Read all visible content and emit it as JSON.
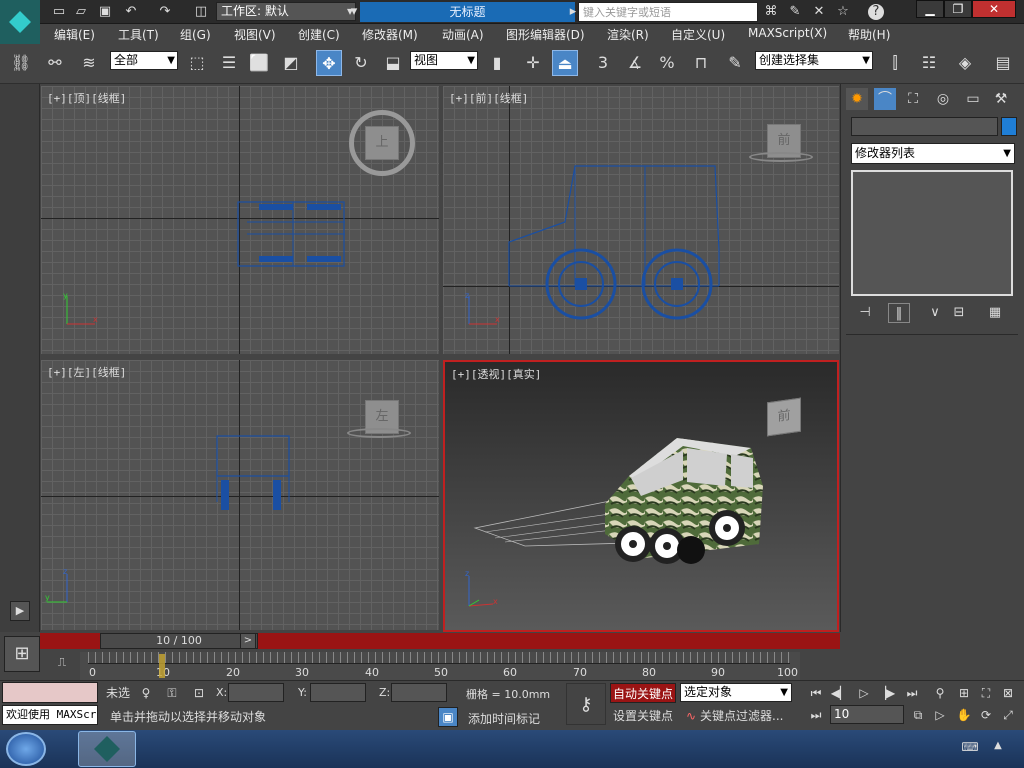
{
  "title": {
    "workspace": "工作区: 默认",
    "document": "无标题",
    "search_placeholder": "键入关键字或短语"
  },
  "menu": [
    "编辑(E)",
    "工具(T)",
    "组(G)",
    "视图(V)",
    "创建(C)",
    "修改器(M)",
    "动画(A)",
    "图形编辑器(D)",
    "渲染(R)",
    "自定义(U)",
    "MAXScript(X)",
    "帮助(H)"
  ],
  "toolbar": {
    "selection_filter": "全部",
    "ref_coord": "视图",
    "named_selection": "创建选择集",
    "snap_3": "3",
    "percent": "%"
  },
  "viewports": {
    "top": "[+][顶][线框]",
    "front": "[+][前][线框]",
    "left": "[+][左][线框]",
    "persp": "[+][透视][真实]",
    "cube_top": "上",
    "cube_front": "前",
    "cube_left": "左",
    "cube_persp": "前"
  },
  "command_panel": {
    "modifier_list": "修改器列表"
  },
  "timeline": {
    "slider_label": "10 / 100",
    "ticks": [
      "0",
      "10",
      "20",
      "30",
      "40",
      "50",
      "60",
      "70",
      "80",
      "90",
      "100"
    ],
    "prev": "<",
    "next": ">"
  },
  "status": {
    "listener_text": "欢迎使用 MAXScr",
    "selection_state": "未选",
    "x_label": "X:",
    "y_label": "Y:",
    "z_label": "Z:",
    "grid": "栅格 = 10.0mm",
    "prompt": "单击并拖动以选择并移动对象",
    "add_time_tag": "添加时间标记",
    "autokey": "自动关键点",
    "set_key": "设置关键点",
    "selected_object": "选定对象",
    "key_filters": "关键点过滤器...",
    "current_frame": "10"
  },
  "colors": {
    "accent_blue": "#1f7ed6",
    "autokey_red": "#9a1414",
    "title_blue": "#1a6bb5"
  }
}
